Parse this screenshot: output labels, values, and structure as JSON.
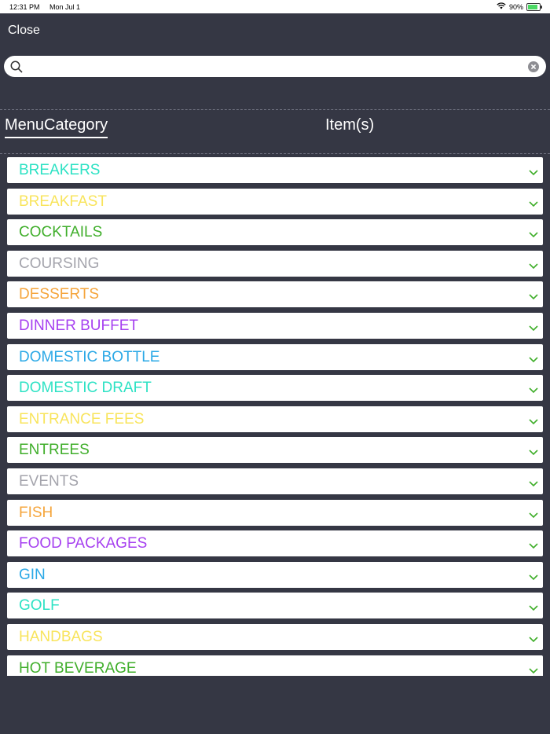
{
  "status_bar": {
    "time": "12:31 PM",
    "date": "Mon Jul 1",
    "battery": "90%"
  },
  "header": {
    "close_label": "Close"
  },
  "search": {
    "value": "",
    "placeholder": ""
  },
  "tabs": {
    "category": "MenuCategory",
    "items": "Item(s)"
  },
  "colors": {
    "background": "#353744",
    "chevron": "#3fae2a",
    "teal": "#2de2c4",
    "yellow": "#f8e45c",
    "green": "#3fae2a",
    "gray": "#a4a4ac",
    "orange": "#f5a53c",
    "purple": "#a640f0",
    "blue": "#2aa8e6"
  },
  "categories": [
    {
      "label": "BREAKERS",
      "color": "#2de2c4"
    },
    {
      "label": "BREAKFAST",
      "color": "#f8e45c"
    },
    {
      "label": "COCKTAILS",
      "color": "#3fae2a"
    },
    {
      "label": "COURSING",
      "color": "#a4a4ac"
    },
    {
      "label": "DESSERTS",
      "color": "#f5a53c"
    },
    {
      "label": "DINNER BUFFET",
      "color": "#a640f0"
    },
    {
      "label": "DOMESTIC BOTTLE",
      "color": "#2aa8e6"
    },
    {
      "label": "DOMESTIC DRAFT",
      "color": "#2de2c4"
    },
    {
      "label": "ENTRANCE FEES",
      "color": "#f8e45c"
    },
    {
      "label": "ENTREES",
      "color": "#3fae2a"
    },
    {
      "label": "EVENTS",
      "color": "#a4a4ac"
    },
    {
      "label": "FISH",
      "color": "#f5a53c"
    },
    {
      "label": "FOOD PACKAGES",
      "color": "#a640f0"
    },
    {
      "label": "GIN",
      "color": "#2aa8e6"
    },
    {
      "label": "GOLF",
      "color": "#2de2c4"
    },
    {
      "label": "HANDBAGS",
      "color": "#f8e45c"
    },
    {
      "label": "HOT BEVERAGE",
      "color": "#3fae2a"
    }
  ]
}
